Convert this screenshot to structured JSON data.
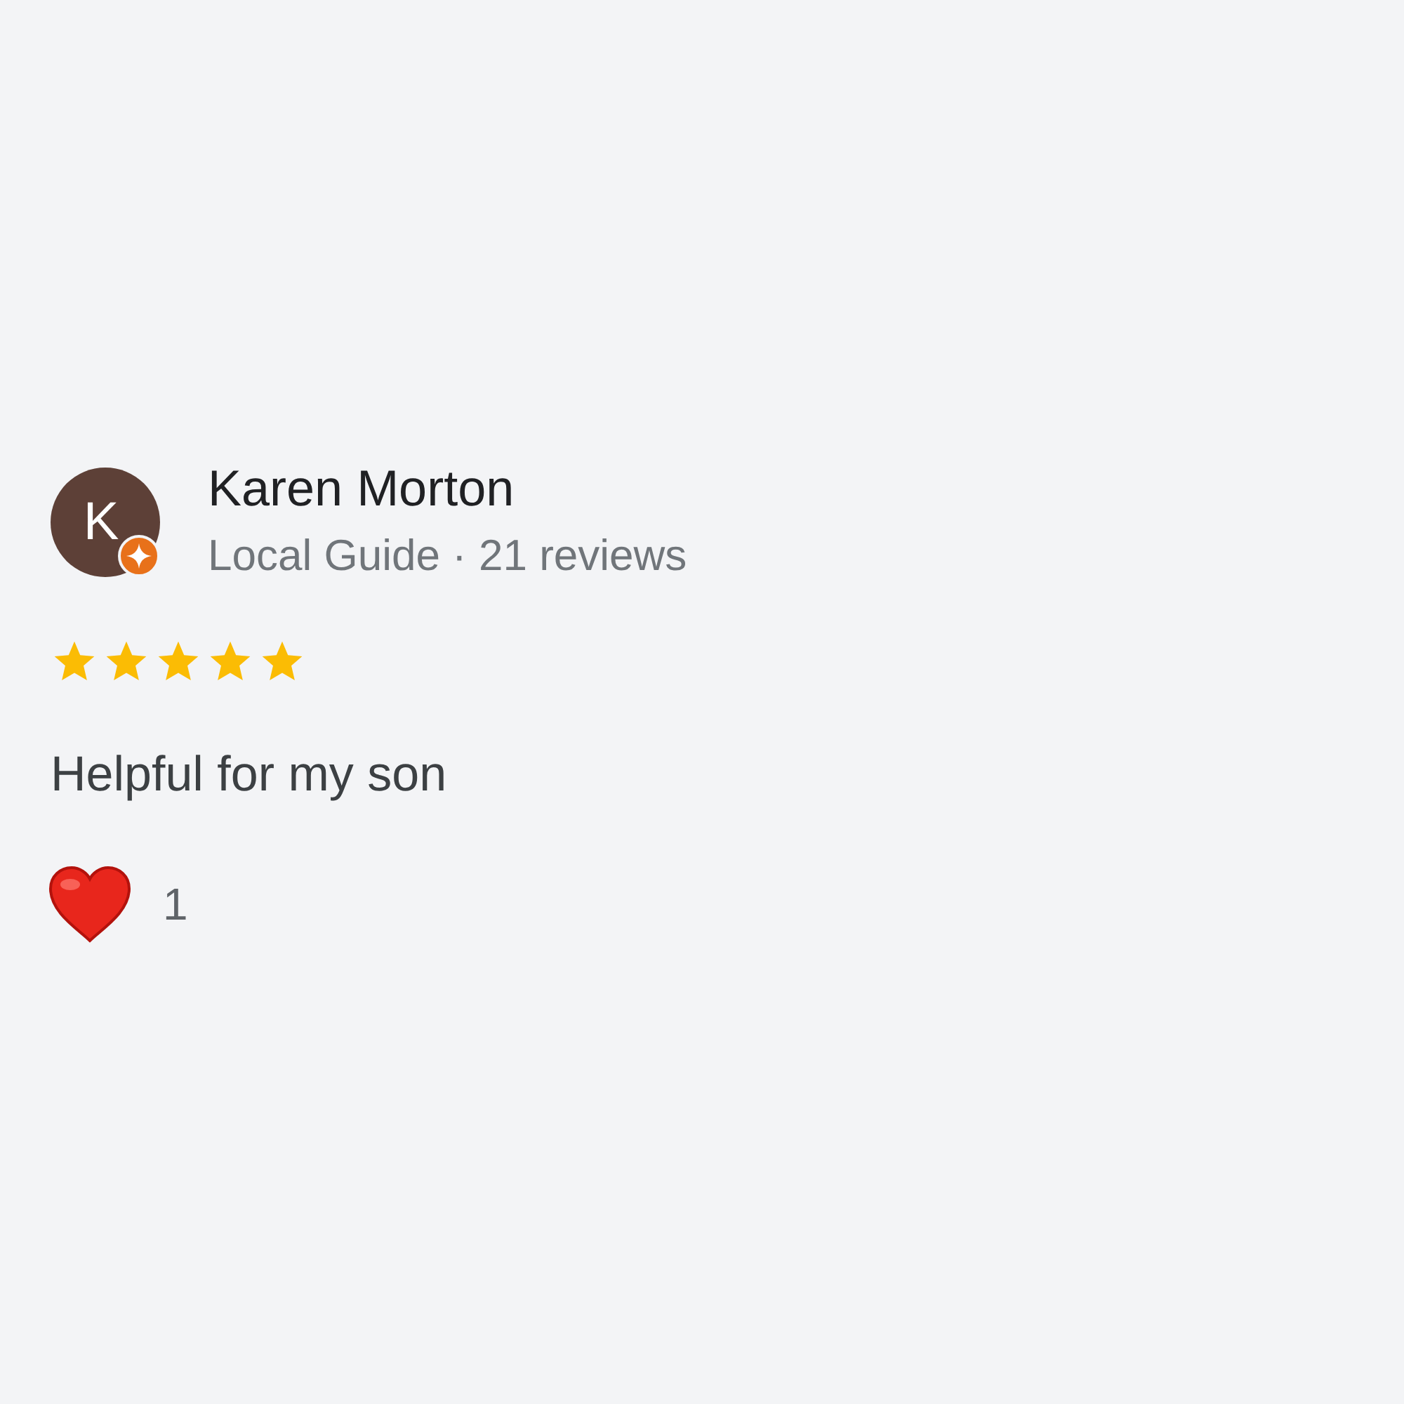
{
  "review": {
    "avatar_letter": "K",
    "local_guide_badge": true,
    "name": "Karen Morton",
    "subtitle": "Local Guide · 21 reviews",
    "stars": 5,
    "text": "Helpful for my son",
    "reaction_count": "1"
  }
}
